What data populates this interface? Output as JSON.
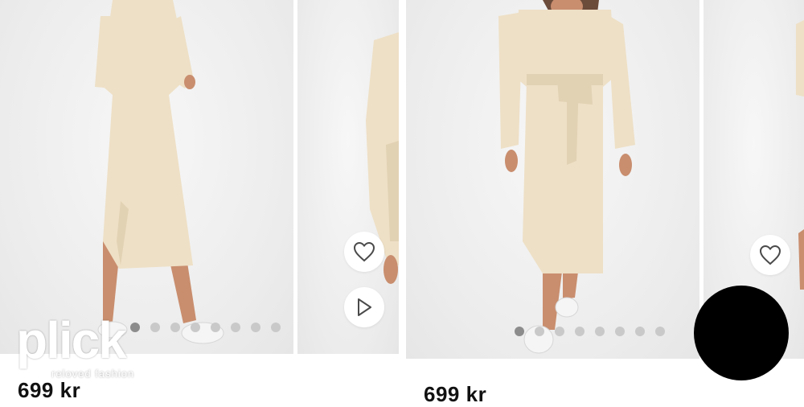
{
  "products": [
    {
      "price": "699 kr",
      "active_dot": 0,
      "dot_count": 8
    },
    {
      "price": "699 kr",
      "active_dot": 0,
      "dot_count": 8
    }
  ],
  "logo": {
    "word": "plick",
    "tagline": "reloved fashion"
  },
  "icons": {
    "heart": "heart-icon",
    "play": "play-icon"
  },
  "colors": {
    "dress": "#eee0c6",
    "background": "#efefef",
    "dot_active": "#8c8c8c",
    "dot_inactive": "#c9c9c9",
    "overlay_circle": "#000000"
  }
}
